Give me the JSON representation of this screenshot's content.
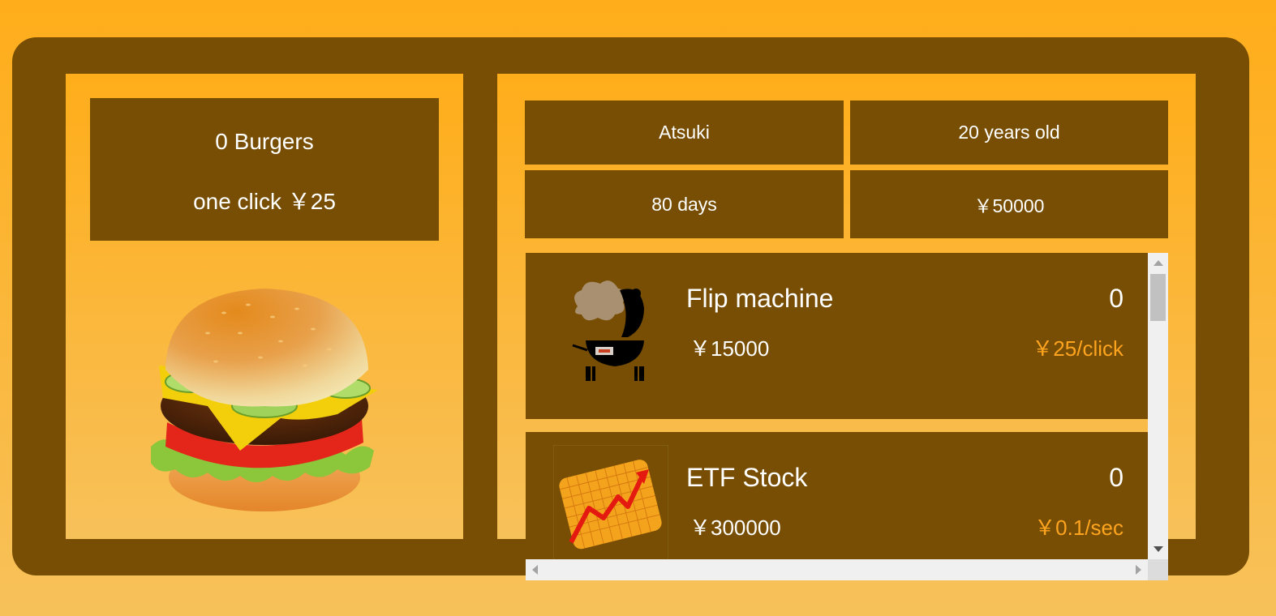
{
  "counter": {
    "burgers_text": "0 Burgers",
    "click_value_text": "one click ￥25"
  },
  "profile": {
    "name": "Atsuki",
    "age": "20 years old",
    "days": "80 days",
    "money": "￥50000"
  },
  "shop": {
    "items": [
      {
        "name": "Flip machine",
        "count": "0",
        "price": "￥15000",
        "rate": "￥25/click",
        "icon": "grill-icon"
      },
      {
        "name": "ETF Stock",
        "count": "0",
        "price": "￥300000",
        "rate": "￥0.1/sec",
        "icon": "stock-chart-icon"
      }
    ]
  },
  "colors": {
    "background": "#ffad1a",
    "panel_dark": "#774e03",
    "accent_orange": "#ffa41f",
    "text": "#ffffff"
  }
}
